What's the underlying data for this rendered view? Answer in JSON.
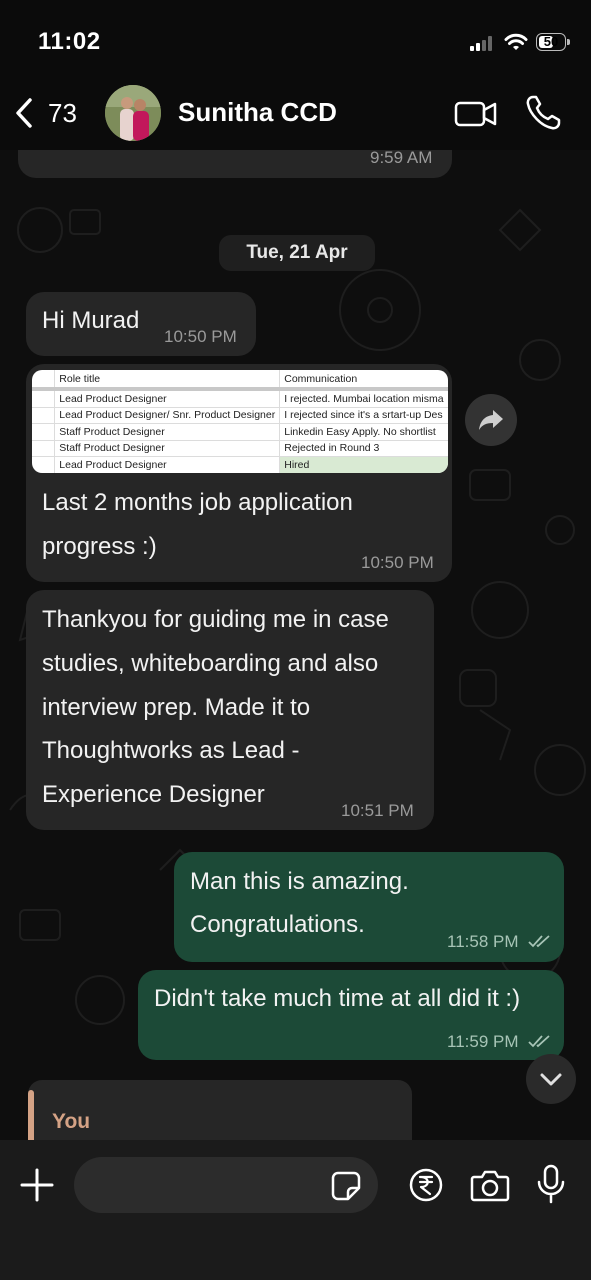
{
  "status_bar": {
    "time": "11:02",
    "battery": "50"
  },
  "header": {
    "back_count": "73",
    "contact_name": "Sunitha CCD"
  },
  "chat": {
    "prev_time": "9:59 AM",
    "date_label": "Tue, 21 Apr",
    "messages": [
      {
        "text": "Hi Murad",
        "time": "10:50 PM"
      },
      {
        "attachment": {
          "columns": [
            "",
            "Role title",
            "Communication"
          ],
          "rows": [
            [
              "",
              "Lead Product Designer",
              "I rejected. Mumbai location misma"
            ],
            [
              "",
              "Lead Product Designer/ Snr. Product Designer",
              "I rejected since it's a srtart-up Des"
            ],
            [
              "",
              "Staff Product Designer",
              "Linkedin Easy Apply. No shortlist"
            ],
            [
              "",
              "Staff Product Designer",
              "Rejected in Round 3"
            ],
            [
              "",
              "Lead Product Designer",
              "Hired"
            ]
          ]
        },
        "line1": "Last 2 months job application",
        "line2": "progress :)",
        "time": "10:50 PM"
      },
      {
        "lines": [
          "Thankyou for guiding me in case",
          "studies, whiteboarding and also",
          "interview prep. Made it to",
          "Thoughtworks as Lead -",
          "Experience Designer"
        ],
        "time": "10:51 PM"
      },
      {
        "lines": [
          "Man this is amazing.",
          "Congratulations."
        ],
        "time": "11:58 PM"
      },
      {
        "text": "Didn't take much time at all did it :)",
        "time": "11:59 PM"
      }
    ],
    "reply_preview_name": "You"
  },
  "colors": {
    "incoming_bubble": "#262626",
    "outgoing_bubble": "#1c4a37",
    "reply_accent": "#d4a285",
    "hired_cell": "#d9ead3"
  },
  "icons": [
    "back-chevron-icon",
    "video-call-icon",
    "phone-icon",
    "forward-icon",
    "chevron-down-icon",
    "plus-icon",
    "sticker-icon",
    "rupee-payment-icon",
    "camera-icon",
    "microphone-icon"
  ]
}
